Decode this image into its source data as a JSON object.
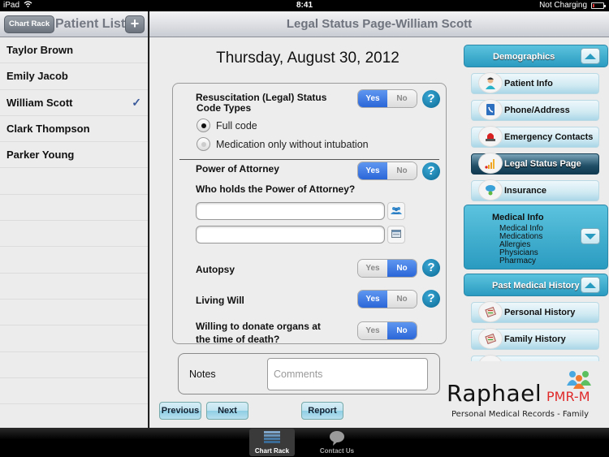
{
  "status_bar": {
    "device": "iPad",
    "time": "8:41",
    "charging": "Not Charging"
  },
  "left_pane": {
    "chart_rack_button": "Chart Rack",
    "title": "Patient List",
    "add_button": "+",
    "patients": [
      {
        "name": "Taylor Brown",
        "selected": false
      },
      {
        "name": "Emily Jacob",
        "selected": false
      },
      {
        "name": "William Scott",
        "selected": true
      },
      {
        "name": "Clark Thompson",
        "selected": false
      },
      {
        "name": "Parker Young",
        "selected": false
      }
    ],
    "check_glyph": "✓"
  },
  "detail": {
    "title": "Legal Status Page-William Scott",
    "date": "Thursday, August 30, 2012",
    "form": {
      "resuscitation": {
        "label_line1": "Resuscitation (Legal) Status",
        "label_line2": "Code Types",
        "value": "Yes",
        "yes": "Yes",
        "no": "No",
        "options": [
          {
            "label": "Full code",
            "selected": true
          },
          {
            "label": "Medication only without intubation",
            "selected": false
          }
        ]
      },
      "power_of_attorney": {
        "label": "Power of Attorney",
        "value": "Yes",
        "yes": "Yes",
        "no": "No"
      },
      "who_holds": {
        "label": "Who holds the Power of Attorney?",
        "field1_value": "",
        "field2_value": ""
      },
      "autopsy": {
        "label": "Autopsy",
        "value": "No",
        "yes": "Yes",
        "no": "No"
      },
      "living_will": {
        "label": "Living Will",
        "value": "Yes",
        "yes": "Yes",
        "no": "No"
      },
      "donate_organs": {
        "label_line1": "Willing to donate organs at",
        "label_line2": "the time of death?",
        "value": "No",
        "yes": "Yes",
        "no": "No"
      },
      "help_glyph": "?"
    },
    "notes": {
      "label": "Notes",
      "placeholder": "Comments",
      "value": ""
    },
    "buttons": {
      "previous": "Previous",
      "next": "Next",
      "report": "Report"
    }
  },
  "sidebar": {
    "demographics": {
      "title": "Demographics",
      "expanded": true,
      "items": [
        {
          "label": "Patient Info",
          "icon": "patient-icon",
          "active": false
        },
        {
          "label": "Phone/Address",
          "icon": "phone-book-icon",
          "active": false
        },
        {
          "label": "Emergency Contacts",
          "icon": "siren-icon",
          "active": false
        },
        {
          "label": "Legal Status Page",
          "icon": "bar-chart-icon",
          "active": true
        },
        {
          "label": "Insurance",
          "icon": "insurance-icon",
          "active": false
        }
      ]
    },
    "medical_info": {
      "title": "Medical Info",
      "expanded": false,
      "sub_items": [
        "Medical Info",
        "Medications",
        "Allergies",
        "Physicians",
        "Pharmacy"
      ]
    },
    "past_medical_history": {
      "title": "Past Medical History",
      "expanded": true,
      "items": [
        {
          "label": "Personal History",
          "icon": "history-book-icon"
        },
        {
          "label": "Family History",
          "icon": "history-book-icon"
        }
      ]
    }
  },
  "logo": {
    "name": "Raphael",
    "product": "PMR-M",
    "tagline": "Personal Medical Records - Family"
  },
  "tab_bar": {
    "tabs": [
      {
        "label": "Chart Rack",
        "selected": true
      },
      {
        "label": "Contact Us",
        "selected": false
      }
    ]
  },
  "colors": {
    "accent_blue": "#2b66d8",
    "sidebar_teal": "#2a9bc0",
    "help_blue": "#0b6a95",
    "logo_red": "#e02a2a"
  }
}
